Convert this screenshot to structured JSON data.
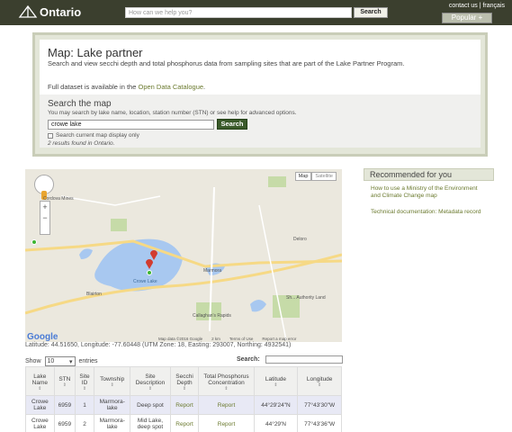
{
  "header": {
    "brand": "Ontario",
    "search_placeholder": "How can we help you?",
    "search_button": "Search",
    "contact": "contact us",
    "lang_separator": "|",
    "lang": "français",
    "popular": "Popular +"
  },
  "panel": {
    "title": "Map: Lake partner",
    "description": "Search and view secchi depth and total phosphorus data from sampling sites that are part of the Lake Partner Program.",
    "dataset_prefix": "Full dataset is available in the ",
    "dataset_link": "Open Data Catalogue",
    "dataset_suffix": ".",
    "search_title": "Search the map",
    "search_help": "You may search by lake name, location, station number (STN) or see help for advanced options.",
    "search_value": "crowe lake",
    "search_button": "Search",
    "checkbox_label": "Search current map display only",
    "results": "2 results found in Ontario."
  },
  "map": {
    "map_type_map": "Map",
    "map_type_satellite": "Satellite",
    "place_labels": [
      "Cordova Mines",
      "Marmora",
      "Deloro",
      "Blairton",
      "Callaghan's Rapids",
      "Sh... Authority Land",
      "Crowe Lake"
    ],
    "footer_data": "Map data ©2016 Google",
    "footer_scale": "2 km",
    "footer_terms": "Terms of Use",
    "footer_report": "Report a map error",
    "google": "Google",
    "coords": "Latitude: 44.51650, Longitude: -77.60448 (UTM Zone: 18, Easting: 293007, Northing: 4932541)"
  },
  "table_controls": {
    "show": "Show",
    "entries_value": "10",
    "entries": "entries",
    "search": "Search:"
  },
  "table": {
    "headers": [
      "Lake Name",
      "STN",
      "Site ID",
      "Township",
      "Site Description",
      "Secchi Depth",
      "Total Phosphorus Concentration",
      "Latitude",
      "Longitude"
    ],
    "rows": [
      [
        "Crowe Lake",
        "6959",
        "1",
        "Marmora-lake",
        "Deep spot",
        "Report",
        "Report",
        "44°29'24\"N",
        "77°43'30\"W"
      ],
      [
        "Crowe Lake",
        "6959",
        "2",
        "Marmora-lake",
        "Mid Lake, deep spot",
        "Report",
        "Report",
        "44°29'N",
        "77°43'36\"W"
      ]
    ]
  },
  "recommended": {
    "title": "Recommended for you",
    "links": [
      "How to use a Ministry of the Environment and Climate Change map",
      "Technical documentation: Metadata record"
    ]
  },
  "colors": {
    "header_bg": "#3b3f2e",
    "panel_bg": "#e3e6d8",
    "link": "#6b7a2f",
    "search_button": "#3a5a2a"
  }
}
